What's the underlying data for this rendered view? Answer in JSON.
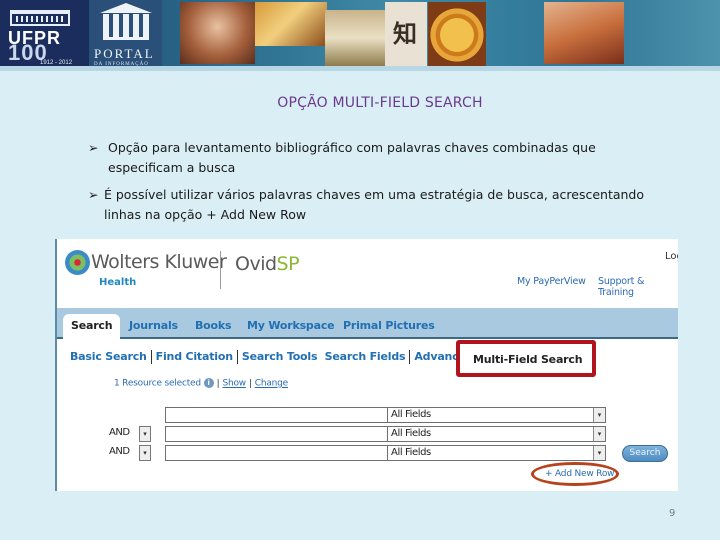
{
  "banner": {
    "ufpr_text": "UFPR",
    "ufpr_100": "100",
    "ufpr_years": "1912 - 2012",
    "portal_text": "PORTAL",
    "portal_sub": "DA INFORMAÇÃO"
  },
  "slide": {
    "title": "OPÇÃO  MULTI-FIELD  SEARCH",
    "bullets": [
      {
        "arrow": "➢",
        "line1": "Opção para levantamento bibliográfico com palavras chaves combinadas que",
        "line2": "especificam a busca"
      },
      {
        "arrow": "➢",
        "line1": "É possível utilizar  vários  palavras chaves em uma estratégia de busca, acrescentando",
        "line2": "linhas na opção   + Add New Row"
      }
    ],
    "page_number": "9"
  },
  "ovid": {
    "brand": "Wolters Kluwer",
    "brand_sub": "Health",
    "product_prefix": "Ovid",
    "product_suffix": "SP",
    "logout": "Log",
    "top_links": [
      "My PayPerView",
      "Support & Training"
    ],
    "tabs": [
      "Search",
      "Journals",
      "Books",
      "My Workspace",
      "Primal Pictures"
    ],
    "active_tab": "Search",
    "subnav": [
      "Basic Search",
      "Find Citation",
      "Search Tools",
      "Search Fields",
      "Advanced Searc"
    ],
    "highlighted_subnav": "Multi-Field Search",
    "resource_text": "1 Resource selected",
    "info_icon": "i",
    "show_link": "Show",
    "change_link": "Change",
    "rows": [
      {
        "operator": "",
        "term": "",
        "field": "All Fields"
      },
      {
        "operator": "AND",
        "term": "",
        "field": "All Fields"
      },
      {
        "operator": "AND",
        "term": "",
        "field": "All Fields"
      }
    ],
    "dropdown_glyph": "▾",
    "search_button": "Search",
    "add_row_link": "+ Add New Row"
  },
  "colors": {
    "title_purple": "#6b3a8e",
    "highlight_red": "#b0141c",
    "circle_orange": "#b5431c",
    "ovid_blue": "#2270b2",
    "tabbar_bg": "#a9c9e0",
    "slide_bg": "#daeef5"
  }
}
